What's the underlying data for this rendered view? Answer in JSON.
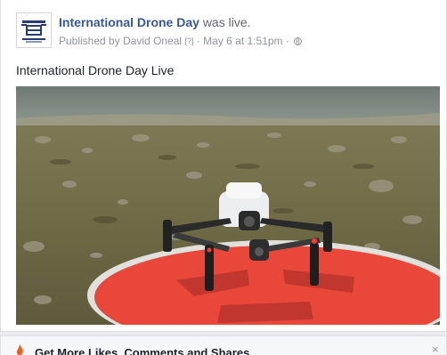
{
  "post": {
    "page_name": "International Drone Day",
    "status_suffix": "was live.",
    "published_prefix": "Published by",
    "author": "David Oneal",
    "help_marker": "[?]",
    "separator": "·",
    "timestamp": "May 6 at 1:51pm",
    "separator2": "·",
    "privacy_icon": "globe-icon",
    "text": "International Drone Day Live",
    "avatar_logo_text": "INTERNATIONAL DRONE DAY"
  },
  "promo": {
    "label": "Get More Likes, Comments and Shares",
    "close_glyph": "×"
  },
  "colors": {
    "link": "#365899",
    "meta": "#90949c",
    "pad_red": "#e8473a"
  }
}
